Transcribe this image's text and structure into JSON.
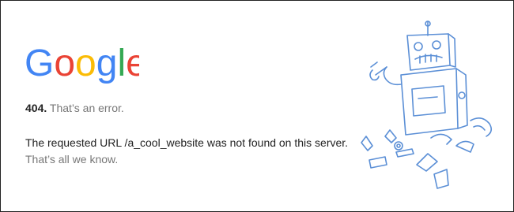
{
  "brand": {
    "logo_text": "Google",
    "colors": {
      "blue": "#4285F4",
      "red": "#EA4335",
      "yellow": "#FBBC05",
      "green": "#34A853"
    }
  },
  "error": {
    "code": "404.",
    "short_message": "That’s an error.",
    "detail_prefix": "The requested URL /a_cool_website was not found on this server.",
    "detail_suffix": "That’s all we know."
  },
  "illustration": {
    "icon": "broken-robot-icon",
    "stroke_color": "#5b8fd6"
  }
}
